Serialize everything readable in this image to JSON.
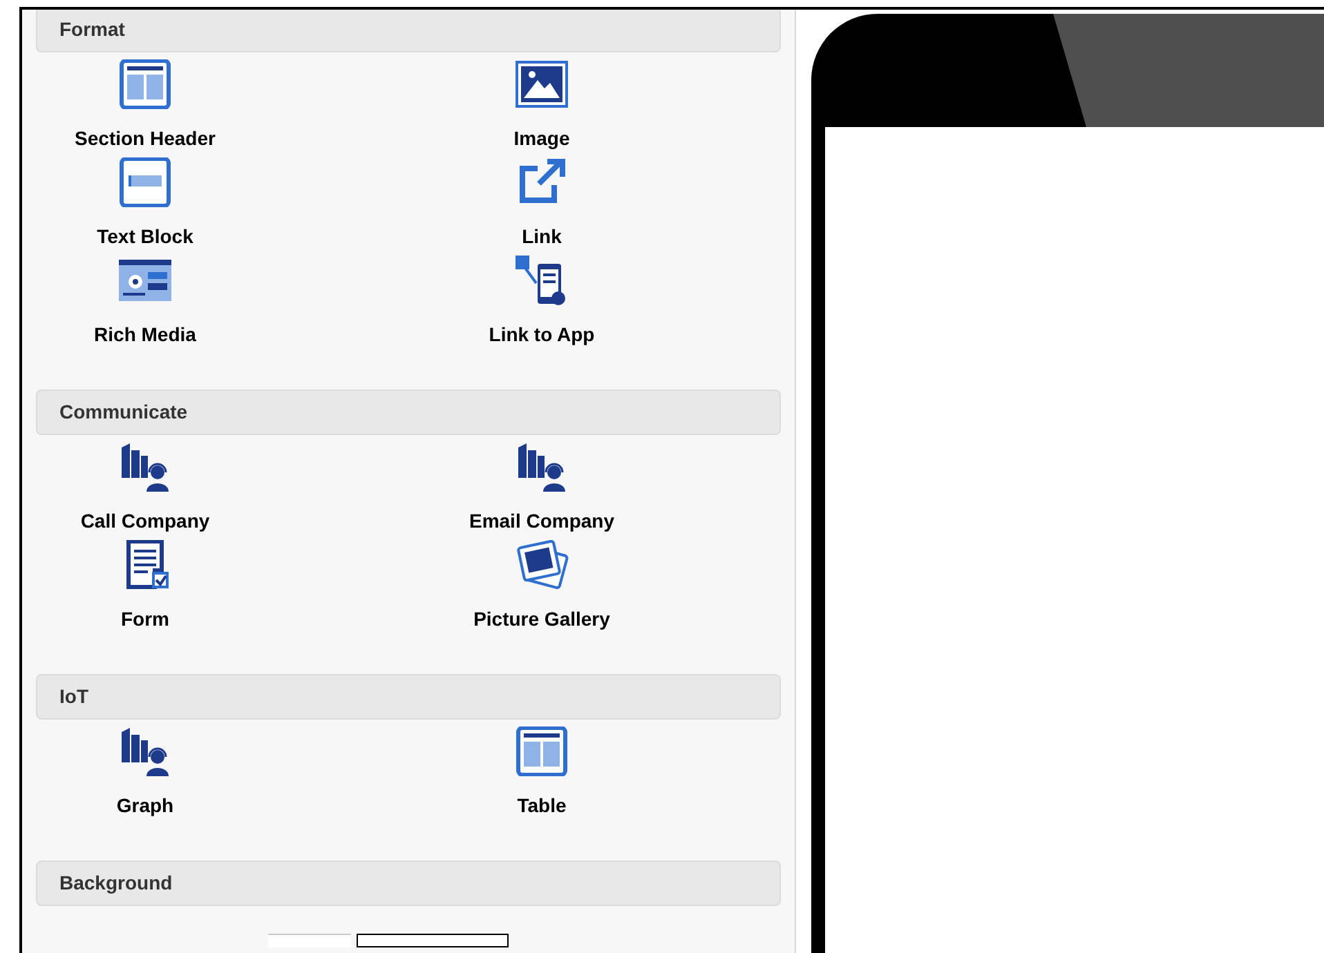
{
  "sections": [
    {
      "title": "Format",
      "items": [
        {
          "label": "Section Header",
          "kind": "section-header"
        },
        {
          "label": "Image",
          "kind": "image"
        },
        {
          "label": "Text Block",
          "kind": "text-block"
        },
        {
          "label": "Link",
          "kind": "link"
        },
        {
          "label": "Rich Media",
          "kind": "rich-media"
        },
        {
          "label": "Link to App",
          "kind": "app-link"
        }
      ]
    },
    {
      "title": "Communicate",
      "items": [
        {
          "label": "Call Company",
          "kind": "contact"
        },
        {
          "label": "Email Company",
          "kind": "contact"
        },
        {
          "label": "Form",
          "kind": "form"
        },
        {
          "label": "Picture Gallery",
          "kind": "gallery"
        }
      ]
    },
    {
      "title": "IoT",
      "items": [
        {
          "label": "Graph",
          "kind": "contact"
        },
        {
          "label": "Table",
          "kind": "section-header"
        }
      ]
    },
    {
      "title": "Background"
    }
  ]
}
